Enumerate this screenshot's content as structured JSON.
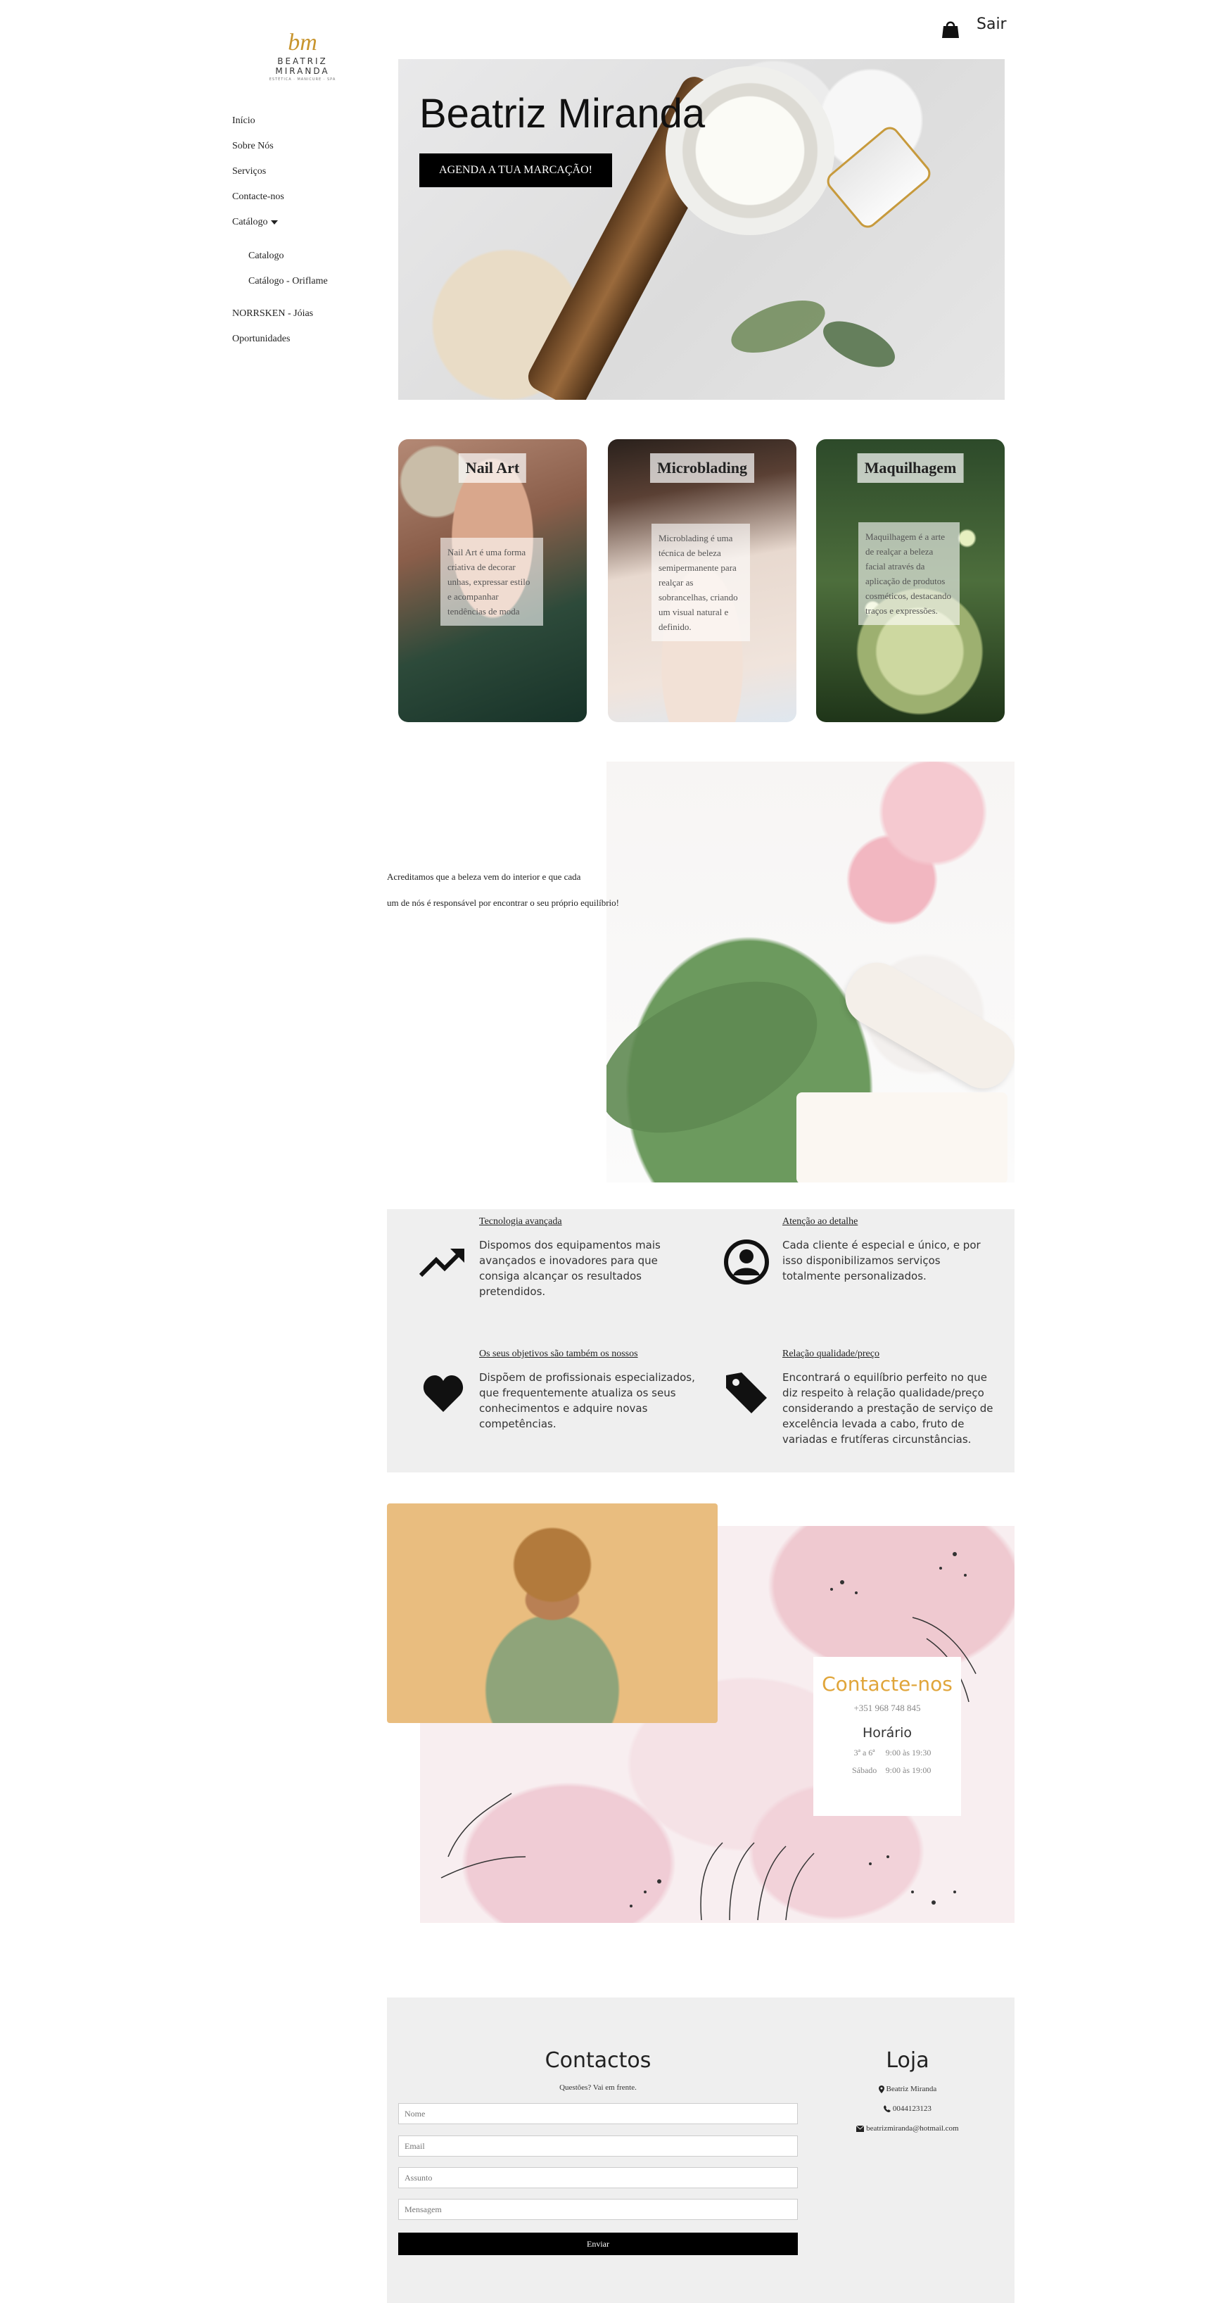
{
  "topbar": {
    "exit_label": "Sair",
    "cart_icon": "shopping-bag-icon"
  },
  "logo": {
    "monogram": "bm",
    "name": "BEATRIZ MIRANDA",
    "subtitle": "ESTÉTICA · MANICURE · SPA"
  },
  "sidebar": {
    "items": [
      {
        "label": "Início"
      },
      {
        "label": "Sobre Nós"
      },
      {
        "label": "Serviços"
      },
      {
        "label": "Contacte-nos"
      },
      {
        "label": "Catálogo"
      }
    ],
    "submenu": [
      {
        "label": "Catalogo"
      },
      {
        "label": "Catálogo - Oriflame"
      }
    ],
    "extra": [
      {
        "label": "NORRSKEN - Jóias"
      },
      {
        "label": "Oportunidades"
      }
    ]
  },
  "hero": {
    "title": "Beatriz Miranda",
    "button_label": "AGENDA A TUA MARCAÇÃO!"
  },
  "services": [
    {
      "title": "Nail Art",
      "description": "Nail Art é uma forma criativa de decorar unhas, expressar estilo e acompanhar tendências de moda"
    },
    {
      "title": "Microblading",
      "description": "Microblading é uma técnica de beleza semipermanente para realçar as sobrancelhas, criando um visual natural e definido."
    },
    {
      "title": "Maquilhagem",
      "description": "Maquilhagem é a arte de realçar a beleza facial através da aplicação de produtos cosméticos, destacando traços e expressões."
    }
  ],
  "belief": {
    "line1": "Acreditamos que a beleza vem do interior e que cada",
    "line2": "um de nós é responsável por encontrar o seu próprio equilíbrio!"
  },
  "features": [
    {
      "title": "Tecnologia avançada",
      "text": "Dispomos dos equipamentos mais avançados e inovadores para que consiga alcançar os resultados pretendidos.",
      "icon": "trending-up-icon"
    },
    {
      "title": "Atenção ao detalhe",
      "text": "Cada cliente é especial e único, e por isso disponibilizamos serviços totalmente personalizados.",
      "icon": "user-circle-icon"
    },
    {
      "title": "Os seus objetivos são também os nossos",
      "text": "Dispõem de profissionais especializados, que frequentemente atualiza os seus conhecimentos e adquire novas competências.",
      "icon": "heart-icon"
    },
    {
      "title": "Relação qualidade/preço",
      "text": "Encontrará o equilíbrio perfeito no que diz respeito à relação qualidade/preço considerando a prestação de serviço de excelência levada a cabo, fruto de variadas e frutíferas circunstâncias.",
      "icon": "price-tag-icon"
    }
  ],
  "contact_card": {
    "title": "Contacte-nos",
    "phone": "+351 968 748 845",
    "hours_title": "Horário",
    "hours": [
      {
        "day": "3ª a 6ª",
        "time": "9:00 às 19:30"
      },
      {
        "day": "Sábado",
        "time": "9:00 às 19:00"
      }
    ]
  },
  "contact_form": {
    "title": "Contactos",
    "subtitle": "Questões? Vai em frente.",
    "fields": [
      {
        "placeholder": "Nome"
      },
      {
        "placeholder": "Email"
      },
      {
        "placeholder": "Assunto"
      },
      {
        "placeholder": "Mensagem"
      }
    ],
    "submit_label": "Enviar"
  },
  "store": {
    "title": "Loja",
    "name": "Beatriz Miranda",
    "phone": "0044123123",
    "email": "beatrizmiranda@hotmail.com"
  },
  "colors": {
    "accent": "#e0a53a",
    "panel": "#efefef",
    "button": "#000000"
  }
}
